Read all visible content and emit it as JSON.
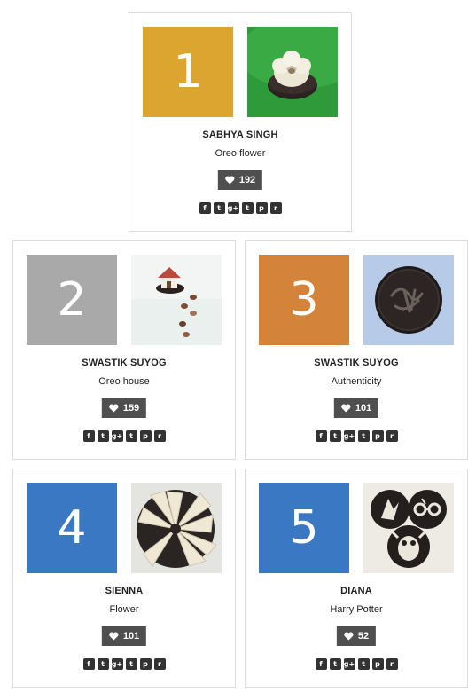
{
  "entries": [
    {
      "rank": "1",
      "name": "SABHYA SINGH",
      "title": "Oreo flower",
      "likes": "192",
      "rank_color": "#dba530",
      "image": "white fondant flower on oreo cookie on green plate"
    },
    {
      "rank": "2",
      "name": "SWASTIK SUYOG",
      "title": "Oreo house",
      "likes": "159",
      "rank_color": "#a9a9a9",
      "image": "small fondant house with chocolate pieces path"
    },
    {
      "rank": "3",
      "name": "SWASTIK SUYOG",
      "title": "Authenticity",
      "likes": "101",
      "rank_color": "#d3843a",
      "image": "oreo cookie with carved initials on blue background"
    },
    {
      "rank": "4",
      "name": "SIENNA",
      "title": "Flower",
      "likes": "101",
      "rank_color": "#3a78c3",
      "image": "white cream poinsettia flower on cookie"
    },
    {
      "rank": "5",
      "name": "DIANA",
      "title": "Harry Potter",
      "likes": "52",
      "rank_color": "#3a78c3",
      "image": "three oreo cookies with Harry Potter cream carvings"
    }
  ],
  "share_icons": [
    "facebook-icon",
    "twitter-icon",
    "google-plus-icon",
    "tumblr-icon",
    "pinterest-icon",
    "reddit-icon"
  ],
  "share_glyphs": [
    "f",
    "t",
    "g+",
    "t",
    "p",
    "r"
  ],
  "like_icon": "heart-icon"
}
